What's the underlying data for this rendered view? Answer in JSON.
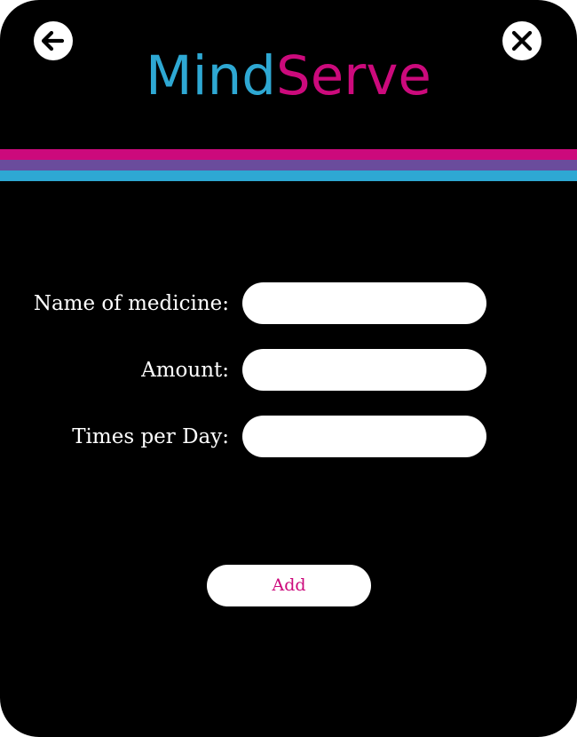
{
  "app": {
    "logo_part_1": "Mind",
    "logo_part_2": "Serve"
  },
  "colors": {
    "logo_blue": "#2ea8d3",
    "logo_magenta": "#cc0a7c",
    "stripe_top": "#cc0a7c",
    "stripe_middle": "#6a4c9c",
    "stripe_bottom": "#2ea8d3",
    "background": "#000000"
  },
  "header": {
    "back_icon": "arrow-left-icon",
    "close_icon": "close-x-icon"
  },
  "form": {
    "fields": [
      {
        "label": "Name of medicine:",
        "value": ""
      },
      {
        "label": "Amount:",
        "value": ""
      },
      {
        "label": "Times per Day:",
        "value": ""
      }
    ],
    "submit_label": "Add"
  }
}
